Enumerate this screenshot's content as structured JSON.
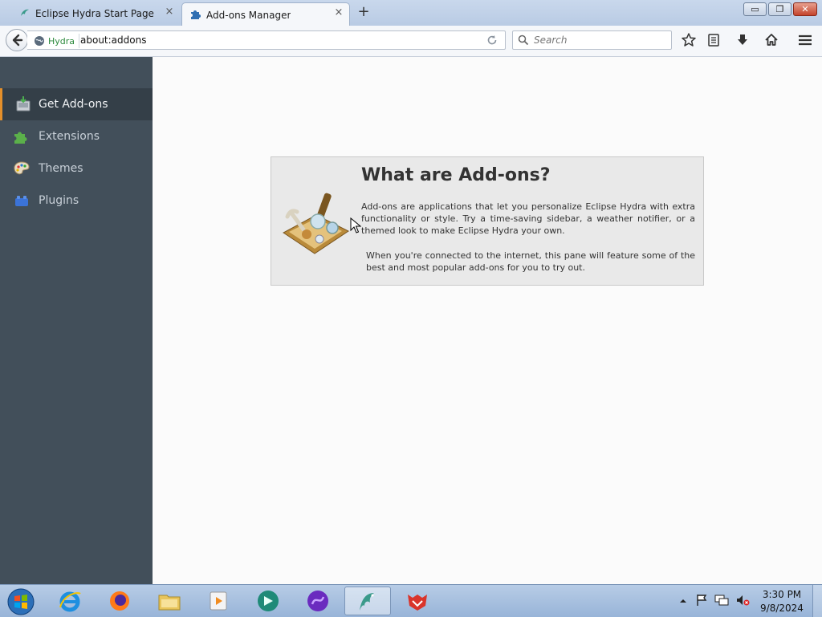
{
  "tabs": [
    {
      "label": "Eclipse Hydra Start Page",
      "close": "×"
    },
    {
      "label": "Add-ons Manager",
      "close": "×"
    }
  ],
  "new_tab": "+",
  "window_controls": {
    "minimize": "▭",
    "maximize": "❐",
    "close": "✕"
  },
  "navbar": {
    "identity_label": "Hydra",
    "url": "about:addons",
    "search_placeholder": "Search"
  },
  "sidebar": {
    "items": [
      {
        "label": "Get Add-ons",
        "icon": "get-addons-icon",
        "selected": true
      },
      {
        "label": "Extensions",
        "icon": "puzzle-icon",
        "selected": false
      },
      {
        "label": "Themes",
        "icon": "palette-icon",
        "selected": false
      },
      {
        "label": "Plugins",
        "icon": "plugin-brick-icon",
        "selected": false
      }
    ]
  },
  "discover": {
    "title": "What are Add-ons?",
    "paragraph1": "Add-ons are applications that let you personalize Eclipse Hydra with extra functionality or style. Try a time-saving sidebar, a weather notifier, or a themed look to make Eclipse Hydra your own.",
    "paragraph2": "When you're connected to the internet, this pane will feature some of the best and most popular add-ons for you to try out."
  },
  "taskbar": {
    "apps": [
      "internet-explorer-icon",
      "firefox-icon",
      "file-explorer-icon",
      "media-player-icon",
      "app-icon-teal",
      "app-icon-purple",
      "hydra-browser-icon",
      "red-fox-app-icon"
    ],
    "clock_time": "3:30 PM",
    "clock_date": "9/8/2024"
  },
  "colors": {
    "sidebar_bg": "#424f5a",
    "sidebar_selected_bg": "#343f48",
    "accent": "#e48f2a",
    "content_bg": "#fbfbfb"
  }
}
